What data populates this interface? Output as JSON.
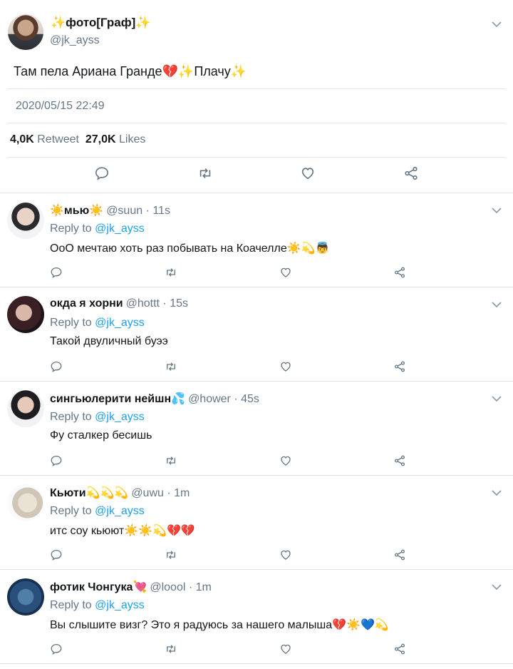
{
  "main_tweet": {
    "display_name": "✨фото[Граф]✨",
    "handle": "@jk_ayss",
    "text": "Там пела Ариана Гранде💔✨Плачу✨",
    "timestamp": "2020/05/15 22:49",
    "retweet_count": "4,0K",
    "retweet_label": "Retweet",
    "likes_count": "27,0K",
    "likes_label": "Likes"
  },
  "replies": [
    {
      "display_name": "☀️мью☀️",
      "meta": "@suun · 11s",
      "reply_label": "Reply to",
      "reply_to": "@jk_ayss",
      "text": "ОоО мечтаю хоть раз побывать на Коачелле☀️💫👼"
    },
    {
      "display_name": "окда я хорни",
      "meta": "@hottt · 15s",
      "reply_label": "Reply to",
      "reply_to": "@jk_ayss",
      "text": "Такой двуличный буээ"
    },
    {
      "display_name": "сингьюлерити нейшн💦",
      "meta": "@hower · 45s",
      "reply_label": "Reply to",
      "reply_to": "@jk_ayss",
      "text": "Фу сталкер бесишь"
    },
    {
      "display_name": "Кьюти💫💫💫",
      "meta": "@uwu · 1m",
      "reply_label": "Reply to",
      "reply_to": "@jk_ayss",
      "text": "итс соу кьюют☀️☀️💫💔💔"
    },
    {
      "display_name": "фотик Чонгука💘",
      "meta": "@loool · 1m",
      "reply_label": "Reply to",
      "reply_to": "@jk_ayss",
      "text": "Вы слышите визг? Это я радуюсь за нашего малыша💔☀️💙💫"
    }
  ],
  "colors": {
    "link": "#1da1f2",
    "muted": "#657786",
    "text": "#14171a",
    "divider": "#e1e6ea"
  },
  "icons": [
    "reply-icon",
    "retweet-icon",
    "like-icon",
    "share-icon",
    "chevron-down-icon"
  ]
}
